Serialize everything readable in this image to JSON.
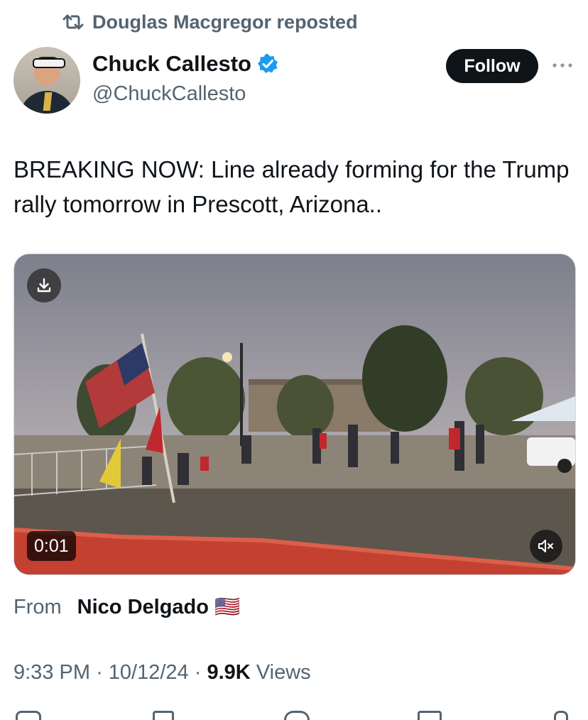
{
  "repost": {
    "text": "Douglas Macgregor reposted",
    "icon": "repost-icon"
  },
  "author": {
    "name": "Chuck Callesto",
    "handle": "@ChuckCallesto",
    "verified_icon": "verified-badge-icon",
    "verified_color": "#1d9bf0"
  },
  "follow_button": {
    "label": "Follow"
  },
  "more_icon": "more-options-icon",
  "tweet": {
    "text": "BREAKING NOW: Line already forming for the Trump rally tomorrow in Prescott, Arizona.."
  },
  "media": {
    "type": "video",
    "duration": "0:01",
    "download_icon": "download-icon",
    "mute_icon": "muted-speaker-icon"
  },
  "source": {
    "label": "From",
    "name": "Nico Delgado",
    "flag": "🇺🇸"
  },
  "meta": {
    "time": "9:33 PM",
    "separator": "·",
    "date": "10/12/24",
    "views_count": "9.9K",
    "views_label": "Views"
  },
  "colors": {
    "primary_text": "#0f1419",
    "secondary_text": "#536471",
    "follow_bg": "#0f1419"
  }
}
